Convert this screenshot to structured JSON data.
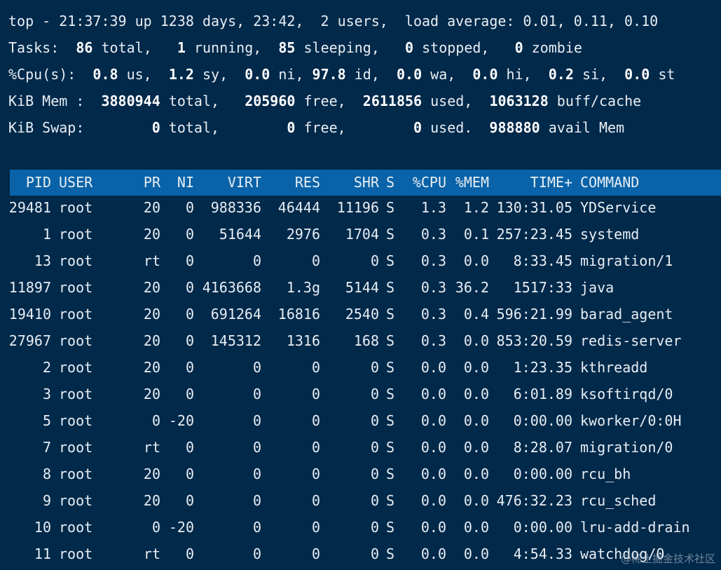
{
  "summary": {
    "line1": "top - 21:37:39 up 1238 days, 23:42,  2 users,  load average: 0.01, 0.11, 0.10",
    "tasks": {
      "label": "Tasks:",
      "total": "86",
      "total_label": "total,",
      "running": "1",
      "running_label": "running,",
      "sleeping": "85",
      "sleeping_label": "sleeping,",
      "stopped": "0",
      "stopped_label": "stopped,",
      "zombie": "0",
      "zombie_label": "zombie"
    },
    "cpu": {
      "label": "%Cpu(s):",
      "us": "0.8",
      "us_label": "us,",
      "sy": "1.2",
      "sy_label": "sy,",
      "ni": "0.0",
      "ni_label": "ni,",
      "id": "97.8",
      "id_label": "id,",
      "wa": "0.0",
      "wa_label": "wa,",
      "hi": "0.0",
      "hi_label": "hi,",
      "si": "0.2",
      "si_label": "si,",
      "st": "0.0",
      "st_label": "st"
    },
    "mem": {
      "label": "KiB Mem :",
      "total": "3880944",
      "total_label": "total,",
      "free": "205960",
      "free_label": "free,",
      "used": "2611856",
      "used_label": "used,",
      "cache": "1063128",
      "cache_label": "buff/cache"
    },
    "swap": {
      "label": "KiB Swap:",
      "total": "0",
      "total_label": "total,",
      "free": "0",
      "free_label": "free,",
      "used": "0",
      "used_label": "used.",
      "avail": "988880",
      "avail_label": "avail Mem"
    }
  },
  "table": {
    "columns": [
      "PID",
      "USER",
      "PR",
      "NI",
      "VIRT",
      "RES",
      "SHR",
      "S",
      "%CPU",
      "%MEM",
      "TIME+",
      "COMMAND"
    ],
    "rows": [
      [
        "29481",
        "root",
        "20",
        "0",
        "988336",
        "46444",
        "11196",
        "S",
        "1.3",
        "1.2",
        "130:31.05",
        "YDService"
      ],
      [
        "1",
        "root",
        "20",
        "0",
        "51644",
        "2976",
        "1704",
        "S",
        "0.3",
        "0.1",
        "257:23.45",
        "systemd"
      ],
      [
        "13",
        "root",
        "rt",
        "0",
        "0",
        "0",
        "0",
        "S",
        "0.3",
        "0.0",
        "8:33.45",
        "migration/1"
      ],
      [
        "11897",
        "root",
        "20",
        "0",
        "4163668",
        "1.3g",
        "5144",
        "S",
        "0.3",
        "36.2",
        "1517:33",
        "java"
      ],
      [
        "19410",
        "root",
        "20",
        "0",
        "691264",
        "16816",
        "2540",
        "S",
        "0.3",
        "0.4",
        "596:21.99",
        "barad_agent"
      ],
      [
        "27967",
        "root",
        "20",
        "0",
        "145312",
        "1316",
        "168",
        "S",
        "0.3",
        "0.0",
        "853:20.59",
        "redis-server"
      ],
      [
        "2",
        "root",
        "20",
        "0",
        "0",
        "0",
        "0",
        "S",
        "0.0",
        "0.0",
        "1:23.35",
        "kthreadd"
      ],
      [
        "3",
        "root",
        "20",
        "0",
        "0",
        "0",
        "0",
        "S",
        "0.0",
        "0.0",
        "6:01.89",
        "ksoftirqd/0"
      ],
      [
        "5",
        "root",
        "0",
        "-20",
        "0",
        "0",
        "0",
        "S",
        "0.0",
        "0.0",
        "0:00.00",
        "kworker/0:0H"
      ],
      [
        "7",
        "root",
        "rt",
        "0",
        "0",
        "0",
        "0",
        "S",
        "0.0",
        "0.0",
        "8:28.07",
        "migration/0"
      ],
      [
        "8",
        "root",
        "20",
        "0",
        "0",
        "0",
        "0",
        "S",
        "0.0",
        "0.0",
        "0:00.00",
        "rcu_bh"
      ],
      [
        "9",
        "root",
        "20",
        "0",
        "0",
        "0",
        "0",
        "S",
        "0.0",
        "0.0",
        "476:32.23",
        "rcu_sched"
      ],
      [
        "10",
        "root",
        "0",
        "-20",
        "0",
        "0",
        "0",
        "S",
        "0.0",
        "0.0",
        "0:00.00",
        "lru-add-drain"
      ],
      [
        "11",
        "root",
        "rt",
        "0",
        "0",
        "0",
        "0",
        "S",
        "0.0",
        "0.0",
        "4:54.33",
        "watchdog/0"
      ]
    ]
  },
  "watermark": "@稀土掘金技术社区",
  "colors": {
    "background": "#01294a",
    "header_bar": "#0a63a8",
    "text": "#e8eef4"
  }
}
